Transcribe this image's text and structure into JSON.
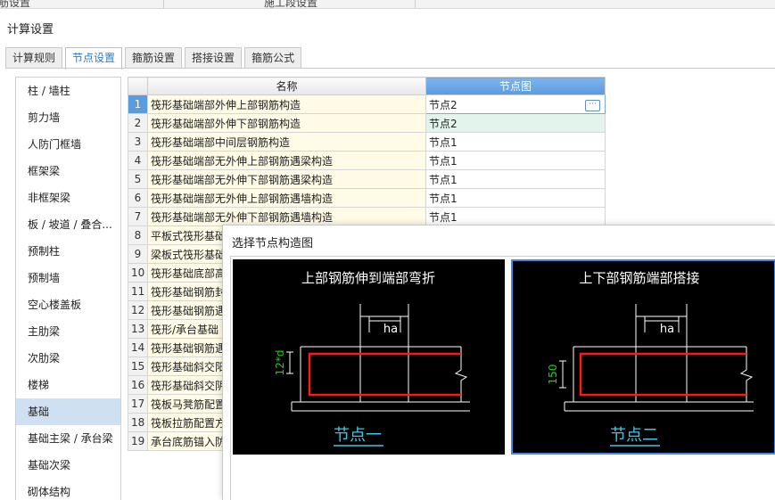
{
  "top_strip": {
    "left_text": "筋设置",
    "right_text": "施工段设置"
  },
  "page_title": "计算设置",
  "tabs": [
    {
      "label": "计算规则",
      "active": false
    },
    {
      "label": "节点设置",
      "active": true
    },
    {
      "label": "箍筋设置",
      "active": false
    },
    {
      "label": "搭接设置",
      "active": false
    },
    {
      "label": "箍筋公式",
      "active": false
    }
  ],
  "sidebar": {
    "items": [
      "柱 / 墙柱",
      "剪力墙",
      "人防门框墙",
      "框架梁",
      "非框架梁",
      "板 / 坡道 / 叠合...",
      "预制柱",
      "预制墙",
      "空心楼盖板",
      "主肋梁",
      "次肋梁",
      "楼梯",
      "基础",
      "基础主梁 / 承台梁",
      "基础次梁",
      "砌体结构"
    ],
    "active_index": 12
  },
  "table": {
    "headers": {
      "name": "名称",
      "image": "节点图"
    },
    "rows": [
      {
        "num": "1",
        "name": "筏形基础端部外伸上部钢筋构造",
        "value": "节点2"
      },
      {
        "num": "2",
        "name": "筏形基础端部外伸下部钢筋构造",
        "value": "节点2"
      },
      {
        "num": "3",
        "name": "筏形基础端部中间层钢筋构造",
        "value": "节点1"
      },
      {
        "num": "4",
        "name": "筏形基础端部无外伸上部钢筋遇梁构造",
        "value": "节点1"
      },
      {
        "num": "5",
        "name": "筏形基础端部无外伸下部钢筋遇梁构造",
        "value": "节点1"
      },
      {
        "num": "6",
        "name": "筏形基础端部无外伸上部钢筋遇墙构造",
        "value": "节点1"
      },
      {
        "num": "7",
        "name": "筏形基础端部无外伸下部钢筋遇墙构造",
        "value": "节点1"
      },
      {
        "num": "8",
        "name": "平板式筏形基础",
        "value": ""
      },
      {
        "num": "9",
        "name": "梁板式筏形基础",
        "value": ""
      },
      {
        "num": "10",
        "name": "筏形基础底部高",
        "value": ""
      },
      {
        "num": "11",
        "name": "筏形基础钢筋封",
        "value": ""
      },
      {
        "num": "12",
        "name": "筏形基础钢筋遇",
        "value": ""
      },
      {
        "num": "13",
        "name": "筏形/承台基础",
        "value": ""
      },
      {
        "num": "14",
        "name": "筏形基础钢筋遇",
        "value": ""
      },
      {
        "num": "15",
        "name": "筏形基础斜交阳",
        "value": ""
      },
      {
        "num": "16",
        "name": "筏形基础斜交阴",
        "value": ""
      },
      {
        "num": "17",
        "name": "筏板马凳筋配置",
        "value": ""
      },
      {
        "num": "18",
        "name": "筏板拉筋配置方",
        "value": ""
      },
      {
        "num": "19",
        "name": "承台底筋锚入防",
        "value": ""
      }
    ],
    "selected_row": 0,
    "ellipsis_label": "···"
  },
  "dialog": {
    "title": "选择节点构造图",
    "nodes": [
      {
        "heading": "上部钢筋伸到端部弯折",
        "dim_label": "ha",
        "side_label": "12*d",
        "caption": "节点一",
        "selected": false
      },
      {
        "heading": "上下部钢筋端部搭接",
        "dim_label": "ha",
        "side_label": "150",
        "caption": "节点二",
        "selected": true
      }
    ]
  },
  "colors": {
    "accent": "#2b7bd0",
    "header_blue": "#5b9be0",
    "name_cell_bg": "#fffbe6",
    "sidebar_active": "#cfe0f3",
    "rebar_red": "#ff1a1a",
    "dim_green": "#19d219",
    "caption_cyan": "#33ccee",
    "panel_border_selected": "#3d8ae8"
  }
}
